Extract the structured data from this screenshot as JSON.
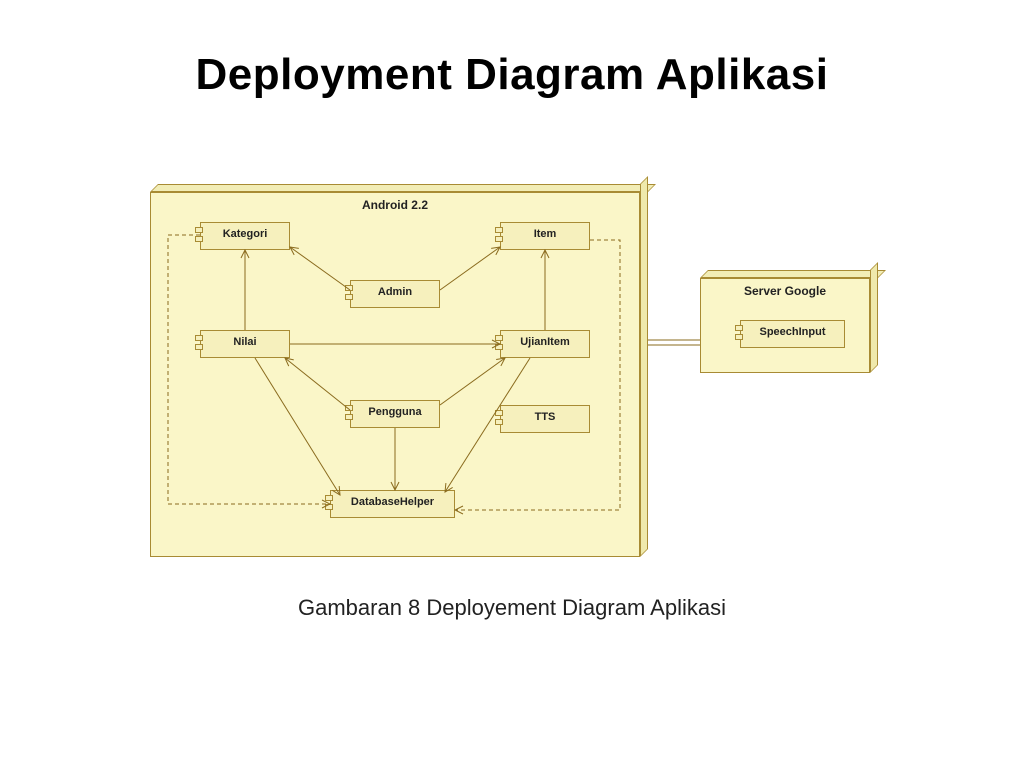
{
  "title": "Deployment Diagram Aplikasi",
  "caption": "Gambaran 8 Deployement Diagram Aplikasi",
  "nodes": {
    "android": "Android 2.2",
    "server": "Server Google"
  },
  "components": {
    "kategori": "Kategori",
    "admin": "Admin",
    "item": "Item",
    "nilai": "Nilai",
    "ujianitem": "UjianItem",
    "pengguna": "Pengguna",
    "tts": "TTS",
    "dbhelper": "DatabaseHelper",
    "speechinput": "SpeechInput"
  }
}
